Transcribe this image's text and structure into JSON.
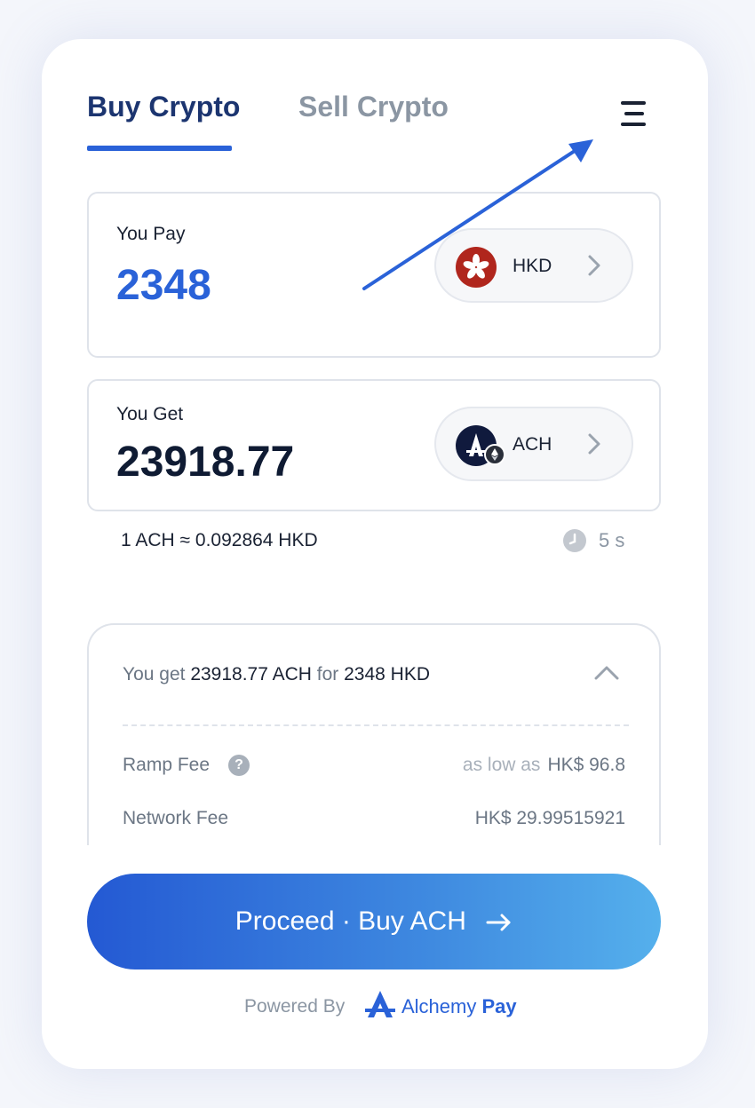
{
  "tabs": {
    "buy": "Buy Crypto",
    "sell": "Sell Crypto"
  },
  "pay": {
    "label": "You Pay",
    "amount": "2348",
    "currency": "HKD"
  },
  "get": {
    "label": "You Get",
    "amount": "23918.77",
    "currency": "ACH"
  },
  "rate": {
    "text": "1 ACH ≈ 0.092864 HKD",
    "timer": "5 s"
  },
  "details": {
    "summary_prefix": "You get",
    "summary_crypto": "23918.77 ACH",
    "summary_mid": "for",
    "summary_fiat": "2348 HKD",
    "ramp_fee_label": "Ramp Fee",
    "ramp_fee_note": "as low as",
    "ramp_fee_value": "HK$ 96.8",
    "network_fee_label": "Network Fee",
    "network_fee_value": "HK$ 29.99515921"
  },
  "proceed_label": "Proceed · Buy ACH",
  "footer": {
    "powered_by": "Powered By",
    "brand_a": "Alchemy",
    "brand_b": "Pay"
  },
  "icons": {
    "menu": "hamburger-menu-icon",
    "pay_currency": "hong-kong-flag-icon",
    "get_currency": "alchemy-ach-token-icon"
  },
  "colors": {
    "accent": "#2a62d8",
    "annotation_arrow": "#2a62d8",
    "hk_red": "#b0261d"
  }
}
